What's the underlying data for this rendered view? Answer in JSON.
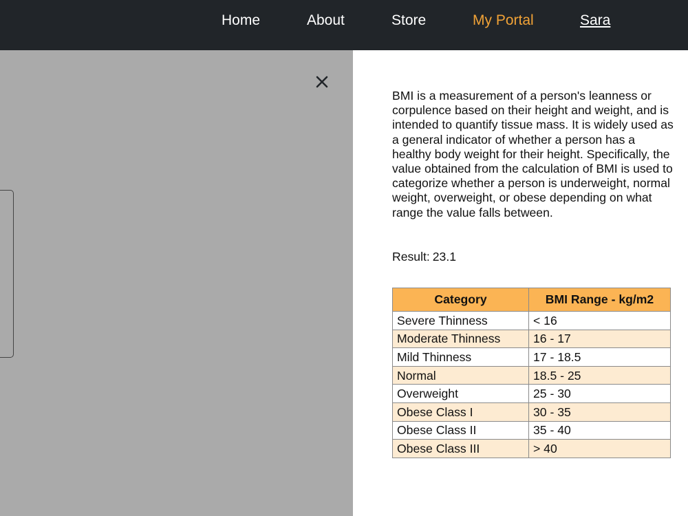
{
  "nav": {
    "items": [
      {
        "label": "Home"
      },
      {
        "label": "About"
      },
      {
        "label": "Store"
      },
      {
        "label": "My Portal"
      },
      {
        "label": "Sara"
      }
    ],
    "active_color": "#f0a237"
  },
  "modal": {
    "close_icon": "close-icon",
    "description": "BMI is a measurement of a person's leanness or corpulence based on their height and weight, and is intended to quantify tissue mass. It is widely used as a general indicator of whether a person has a healthy body weight for their height. Specifically, the value obtained from the calculation of BMI is used to categorize whether a person is underweight, normal weight, overweight, or obese depending on what range the value falls between.",
    "result_label": "Result:",
    "result_value": "23.1"
  },
  "table": {
    "headers": [
      "Category",
      "BMI Range - kg/m2"
    ],
    "rows": [
      [
        "Severe Thinness",
        "< 16"
      ],
      [
        "Moderate Thinness",
        "16 - 17"
      ],
      [
        "Mild Thinness",
        "17 - 18.5"
      ],
      [
        "Normal",
        "18.5 - 25"
      ],
      [
        "Overweight",
        "25 - 30"
      ],
      [
        "Obese Class I",
        "30 - 35"
      ],
      [
        "Obese Class II",
        "35 - 40"
      ],
      [
        "Obese Class III",
        "> 40"
      ]
    ],
    "header_color": "#fbb454",
    "stripe_color": "#fdebd2"
  }
}
